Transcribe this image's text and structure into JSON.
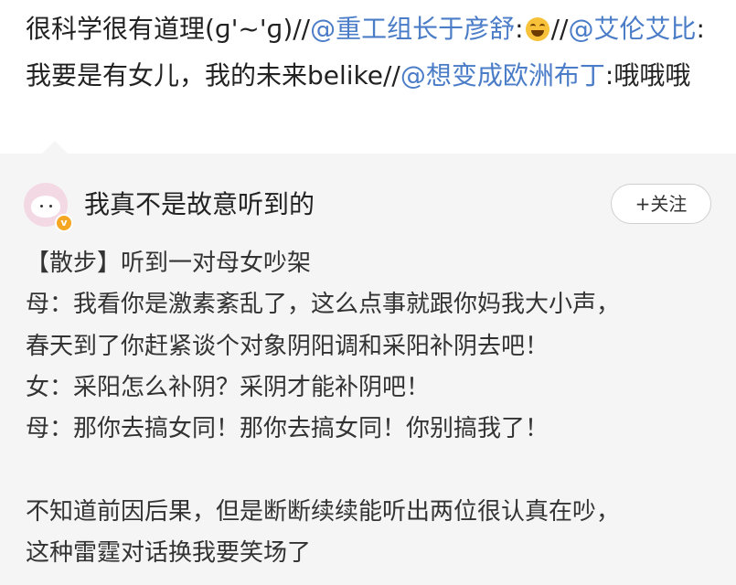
{
  "repost": {
    "seg1": "很科学很有道理(ɡ'~'ɡ)//",
    "mention1": "@重工组长于彦舒",
    "colon1": ":",
    "emoji1": "laughing-tears-emoji",
    "sep1": "//",
    "mention2": "@艾伦艾比",
    "seg2": ":我要是有女儿，我的未来belike//",
    "mention3": "@想变成欧洲布丁",
    "seg3": ":哦哦哦"
  },
  "post": {
    "username": "我真不是故意听到的",
    "follow_label": "+关注",
    "verified_badge": "v",
    "lines": [
      "【散步】听到一对母女吵架",
      "母：我看你是激素紊乱了，这么点事就跟你妈我大小声，",
      "春天到了你赶紧谈个对象阴阳调和采阳补阴去吧！",
      "女：采阳怎么补阴？采阴才能补阴吧！",
      "母：那你去搞女同！那你去搞女同！你别搞我了！",
      "",
      "不知道前因后果，但是断断续续能听出两位很认真在吵，",
      "这种雷霆对话换我要笑场了"
    ]
  },
  "colors": {
    "mention": "#4a7cc7",
    "card_bg": "#f5f5f5",
    "text": "#222222",
    "badge": "#f5a623"
  }
}
